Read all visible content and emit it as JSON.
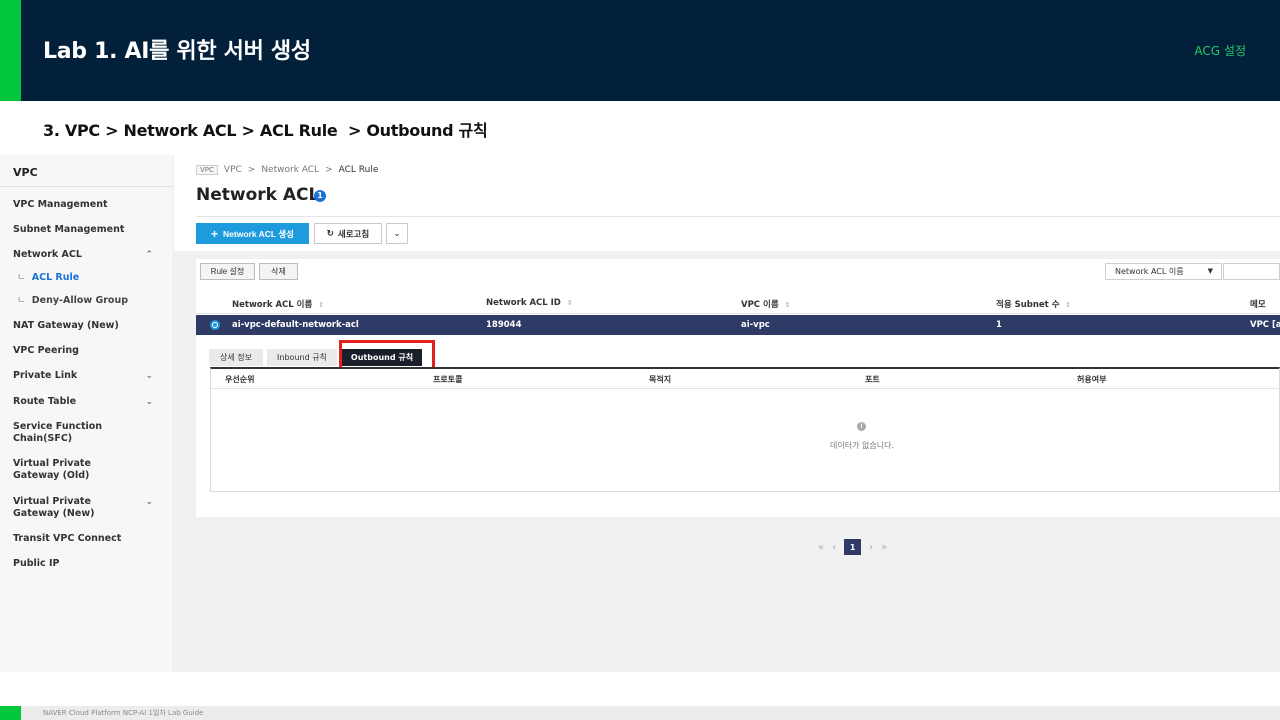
{
  "slide": {
    "title": "Lab 1. AI를 위한 서버 생성",
    "tag": "ACG 설정",
    "step": "3. VPC > Network ACL > ACL Rule  > Outbound 규칙",
    "footer": "NAVER Cloud Platform  NCP-AI 1일차 Lab Guide"
  },
  "sidebar": {
    "title": "VPC",
    "items": [
      {
        "label": "VPC Management",
        "chevron": ""
      },
      {
        "label": "Subnet Management",
        "chevron": ""
      },
      {
        "label": "Network ACL",
        "chevron": "⌃"
      },
      {
        "label": "ACL Rule",
        "chevron": "",
        "active": true,
        "branch": "ㄴ"
      },
      {
        "label": "Deny-Allow Group",
        "chevron": "",
        "branch": "ㄴ"
      },
      {
        "label": "NAT Gateway (New)",
        "chevron": ""
      },
      {
        "label": "VPC Peering",
        "chevron": ""
      },
      {
        "label": "Private Link",
        "chevron": "⌄"
      },
      {
        "label": "Route Table",
        "chevron": "⌄"
      },
      {
        "label": "Service Function Chain(SFC)",
        "chevron": ""
      },
      {
        "label": "Virtual Private Gateway (Old)",
        "chevron": ""
      },
      {
        "label": "Virtual Private Gateway (New)",
        "chevron": "⌄"
      },
      {
        "label": "Transit VPC Connect",
        "chevron": ""
      },
      {
        "label": "Public IP",
        "chevron": ""
      }
    ]
  },
  "main": {
    "breadcrumb": {
      "chip": "VPC",
      "items": [
        "VPC",
        "Network ACL",
        "ACL Rule"
      ],
      "sep": ">"
    },
    "page_title": "Network ACL",
    "title_badge": "1",
    "create_button": "Network ACL 생성",
    "create_plus": "+",
    "refresh_icon": "↻",
    "refresh_button": "새로고침",
    "more_button": "⌄",
    "rule_button": "Rule 설정",
    "delete_button": "삭제",
    "filter": {
      "selected": "Network ACL 이름",
      "arrow": "▼"
    },
    "grid": {
      "sort_icon": "⇕",
      "columns": [
        "Network ACL 이름",
        "Network ACL ID",
        "VPC 이름",
        "적용 Subnet 수",
        "메모"
      ],
      "row": [
        "ai-vpc-default-network-acl",
        "189044",
        "ai-vpc",
        "1",
        "VPC [ai-"
      ]
    },
    "tabs": [
      "상세 정보",
      "Inbound 규칙",
      "Outbound 규칙"
    ],
    "sub_columns": [
      "우선순위",
      "프로토콜",
      "목적지",
      "포트",
      "허용여부"
    ],
    "empty_icon": "!",
    "empty_text": "데이터가 없습니다.",
    "pager": {
      "first": "«",
      "prev": "‹",
      "current": "1",
      "next": "›",
      "last": "»"
    }
  },
  "colors": {
    "header_bg": "#03203a",
    "accent_green": "#00c73c",
    "primary_blue": "#1e9bdc",
    "selected_row": "#2f3a66",
    "highlight_red": "#e41f1f"
  }
}
